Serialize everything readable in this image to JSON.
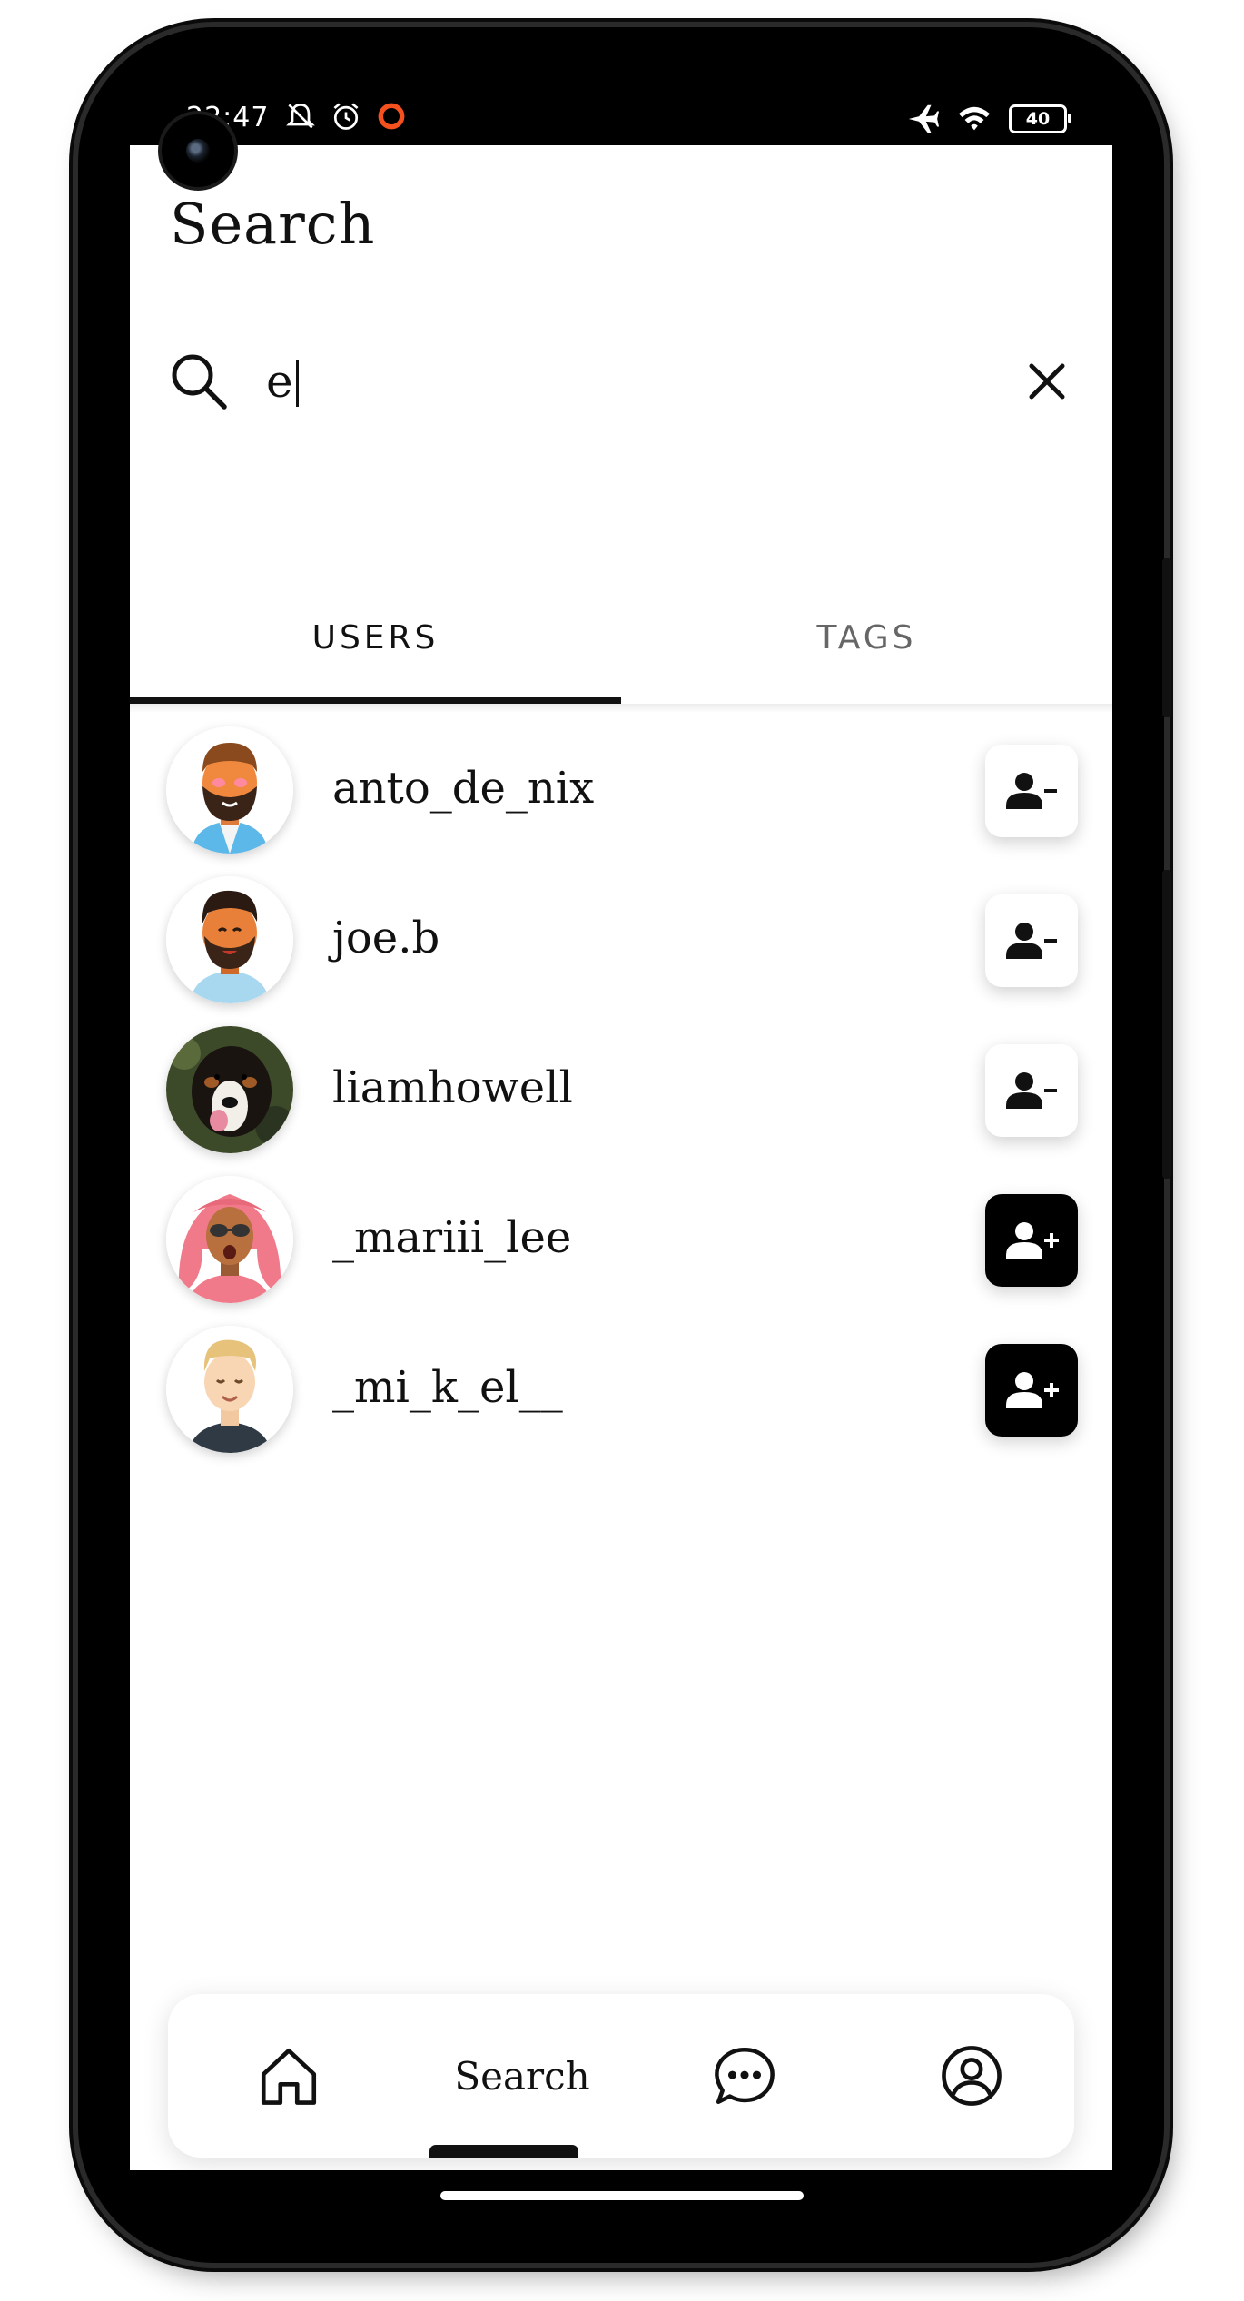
{
  "status_bar": {
    "time": "22:47",
    "battery": "40",
    "left_icons": [
      "notifications-off-icon",
      "alarm-icon",
      "app-notification-icon"
    ],
    "right_icons": [
      "airplane-mode-icon",
      "wifi-icon",
      "battery-icon"
    ]
  },
  "header": {
    "title": "Search"
  },
  "search": {
    "value": "e",
    "icon": "search-icon",
    "clear_icon": "close-icon"
  },
  "tabs": [
    {
      "label": "USERS",
      "active": true
    },
    {
      "label": "TAGS",
      "active": false
    }
  ],
  "users": [
    {
      "username": "anto_de_nix",
      "avatar": "bearded-man-avatar",
      "following": true,
      "action_icon": "person-remove-icon"
    },
    {
      "username": "joe.b",
      "avatar": "bearded-man-avatar",
      "following": true,
      "action_icon": "person-remove-icon"
    },
    {
      "username": "liamhowell",
      "avatar": "dog-photo-avatar",
      "following": true,
      "action_icon": "person-remove-icon"
    },
    {
      "username": "_mariii_lee",
      "avatar": "pink-hair-woman-avatar",
      "following": false,
      "action_icon": "person-add-icon"
    },
    {
      "username": "_mi_k_el__",
      "avatar": "blond-man-avatar",
      "following": false,
      "action_icon": "person-add-icon"
    }
  ],
  "bottom_nav": {
    "items": [
      {
        "icon": "home-icon"
      },
      {
        "label": "Search",
        "active": true
      },
      {
        "icon": "chat-bubble-icon"
      },
      {
        "icon": "account-circle-icon"
      }
    ]
  },
  "colors": {
    "accent": "#000000",
    "background": "#ffffff",
    "notification": "#f4511e"
  }
}
